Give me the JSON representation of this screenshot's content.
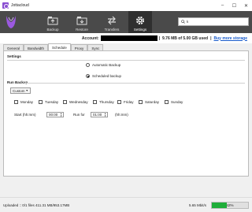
{
  "window": {
    "title": "Jottacloud",
    "controls": [
      "–",
      "☐",
      "✕"
    ]
  },
  "toolbar": {
    "nav": [
      {
        "label": "Backup",
        "icon": "backup-icon"
      },
      {
        "label": "Restore",
        "icon": "restore-icon"
      },
      {
        "label": "Transfers",
        "icon": "transfers-icon"
      },
      {
        "label": "Settings",
        "icon": "gear-icon",
        "active": true
      }
    ],
    "search": {
      "value": "k",
      "icon": "search-icon"
    }
  },
  "account": {
    "label": "Account:",
    "storage": "9.76 MB of 5.00 GB used",
    "separator": "|",
    "buy_link": "Buy more storage"
  },
  "tabs": [
    "General",
    "Bandwidth",
    "Schedule",
    "Proxy",
    "Sync"
  ],
  "active_tab": "Schedule",
  "settings": {
    "title": "Settings",
    "automatic_label": "Automatic Backup",
    "scheduled_label": "Scheduled backup",
    "selected": "scheduled"
  },
  "run_backup": {
    "title": "Run Backup",
    "mode": "Custom",
    "days": [
      "Monday",
      "Tuesday",
      "Wednesday",
      "Thursday",
      "Friday",
      "Saturday",
      "Sunday"
    ],
    "start_label": "Start (hh:mm)",
    "start_value": "00:00",
    "run_for_label": "Run for",
    "run_for_value": "01:00",
    "run_for_unit": "(hh:mm)"
  },
  "status": {
    "text": "Uploaded :: 0/1 files 411.31 MB/953.17MB",
    "speed": "5.65 Mbit/s",
    "progress_percent": 42,
    "progress_text": "42%"
  },
  "colors": {
    "accent": "#8a4fd1",
    "toolbar": "#4a4a4a",
    "progress": "#1fae3a",
    "link": "#1a5ccc"
  }
}
